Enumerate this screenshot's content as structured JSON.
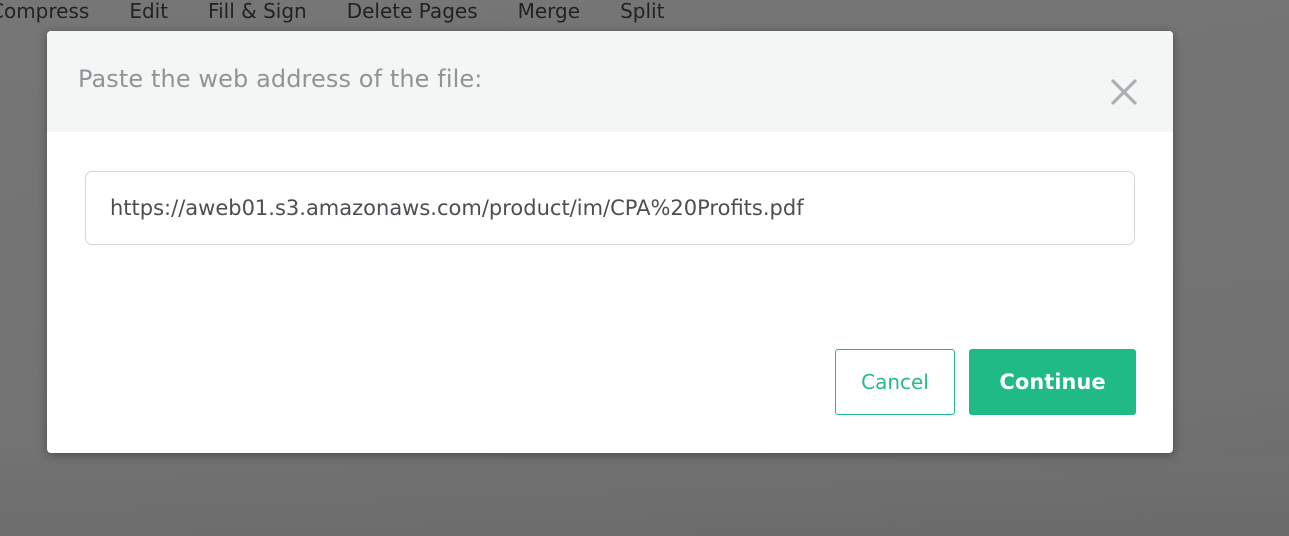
{
  "background_nav": {
    "items": [
      {
        "label": "Compress"
      },
      {
        "label": "Edit"
      },
      {
        "label": "Fill & Sign"
      },
      {
        "label": "Delete Pages"
      },
      {
        "label": "Merge"
      },
      {
        "label": "Split"
      }
    ]
  },
  "modal": {
    "title": "Paste the web address of the file:",
    "close_icon": "close-icon",
    "url_value": "https://aweb01.s3.amazonaws.com/product/im/CPA%20Profits.pdf",
    "cancel_label": "Cancel",
    "continue_label": "Continue"
  },
  "colors": {
    "accent": "#1fba85",
    "overlay": "#6e6e6e",
    "header_bg": "#f4f5f5",
    "title_text": "#8e9599",
    "close_icon": "#a9afb3"
  }
}
